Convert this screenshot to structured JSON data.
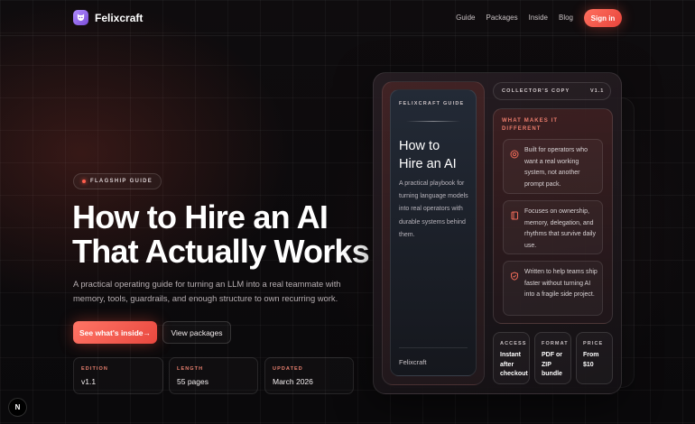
{
  "nav": {
    "brand": "Felixcraft",
    "links": [
      "Guide",
      "Packages",
      "Inside",
      "Blog"
    ],
    "signin_label": "Sign in"
  },
  "hero": {
    "badge": "FLAGSHIP GUIDE",
    "title_line1": "How to Hire an AI",
    "title_line2": "That Actually Works",
    "subtitle": "A practical operating guide for turning an LLM into a real teammate with memory, tools, guardrails, and enough structure to own recurring work.",
    "primary_cta": "See what's inside→",
    "secondary_cta": "View packages",
    "stats": [
      {
        "label": "EDITION",
        "value": "v1.1"
      },
      {
        "label": "LENGTH",
        "value": "55 pages"
      },
      {
        "label": "UPDATED",
        "value": "March 2026"
      }
    ]
  },
  "book": {
    "kicker": "FELIXCRAFT GUIDE",
    "title_line1": "How to",
    "title_line2": "Hire an AI",
    "description": "A practical playbook for turning language models into real operators with durable systems behind them.",
    "brand": "Felixcraft"
  },
  "collector": {
    "label": "COLLECTOR'S COPY",
    "version": "V1.1"
  },
  "features": {
    "title": "WHAT MAKES IT DIFFERENT",
    "items": [
      {
        "text": "Built for operators who want a real working system, not another prompt pack.",
        "icon": "target-icon"
      },
      {
        "text": "Focuses on ownership, memory, delegation, and rhythms that survive daily use.",
        "icon": "notebook-icon"
      },
      {
        "text": "Written to help teams ship faster without turning AI into a fragile side project.",
        "icon": "shield-icon"
      }
    ]
  },
  "details": [
    {
      "label": "ACCESS",
      "value": "Instant after checkout"
    },
    {
      "label": "FORMAT",
      "value": "PDF or ZIP bundle"
    },
    {
      "label": "PRICE",
      "value": "From $10"
    }
  ],
  "dev_badge": "N",
  "colors": {
    "accent": "#ef5444",
    "accent_label": "#e9806f",
    "background": "#0d0b0d",
    "brand_mark": "#9a6cf0"
  }
}
